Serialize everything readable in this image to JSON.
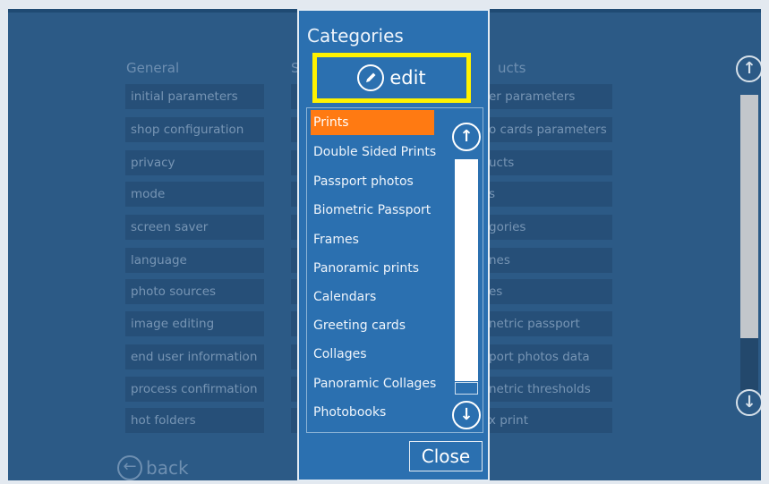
{
  "background": {
    "columns": [
      {
        "label": "General"
      },
      {
        "label": "S"
      },
      {
        "label": "ucts"
      }
    ],
    "general_items": [
      "initial parameters",
      "shop configuration",
      "privacy",
      "mode",
      "screen saver",
      "language",
      "photo sources",
      "image editing",
      "end user information",
      "process confirmation",
      "hot folders"
    ],
    "products_items": [
      "er parameters",
      "o cards parameters",
      "ucts",
      "s",
      "gories",
      "nes",
      "es",
      "netric passport",
      "port photos data",
      "netric thresholds",
      "x print"
    ],
    "back_label": "back",
    "back_icon": "arrow-left-circle-icon",
    "scroll_up_icon": "arrow-up-circle-icon",
    "scroll_down_icon": "arrow-down-circle-icon"
  },
  "dialog": {
    "title": "Categories",
    "edit_label": "edit",
    "edit_icon": "pencil-circle-icon",
    "highlight_color": "#fff200",
    "selected_color": "#ff7a12",
    "items": [
      "Prints",
      "Double Sided Prints",
      "Passport photos",
      "Biometric Passport",
      "Frames",
      "Panoramic prints",
      "Calendars",
      "Greeting cards",
      "Collages",
      "Panoramic Collages",
      "Photobooks"
    ],
    "selected_index": 0,
    "close_label": "Close"
  }
}
